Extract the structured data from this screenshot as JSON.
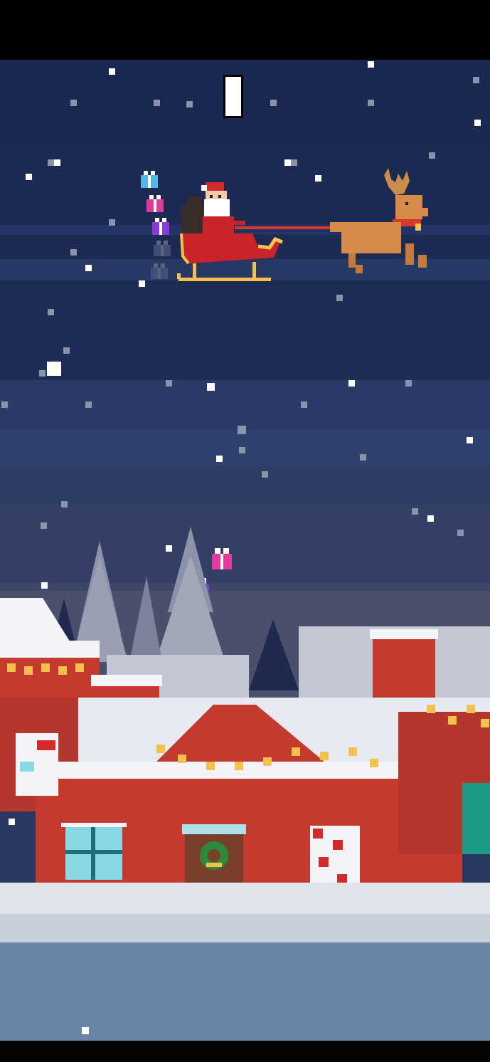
{
  "game": {
    "score": "",
    "player": "santa-sleigh",
    "reindeer_count": 1
  },
  "scene": {
    "sky_color": "#1f2d58",
    "roof_snow_color": "#f2f4f8",
    "brick_color": "#c43a2e",
    "light_color": "#f2c14e",
    "ground_color": "#6885a8"
  },
  "trail_presents": [
    {
      "color": "#4fb8e8",
      "icon": "present-icon"
    },
    {
      "color": "#e03a9c",
      "icon": "present-icon"
    },
    {
      "color": "#8a3ad6",
      "icon": "present-icon"
    },
    {
      "color": "#6a7a9a",
      "icon": "present-icon"
    },
    {
      "color": "#6a7a9a",
      "icon": "present-icon"
    }
  ],
  "falling_presents": [
    {
      "color": "#e03a9c",
      "icon": "present-icon"
    },
    {
      "color": "#8a3ad6",
      "icon": "present-icon"
    }
  ]
}
